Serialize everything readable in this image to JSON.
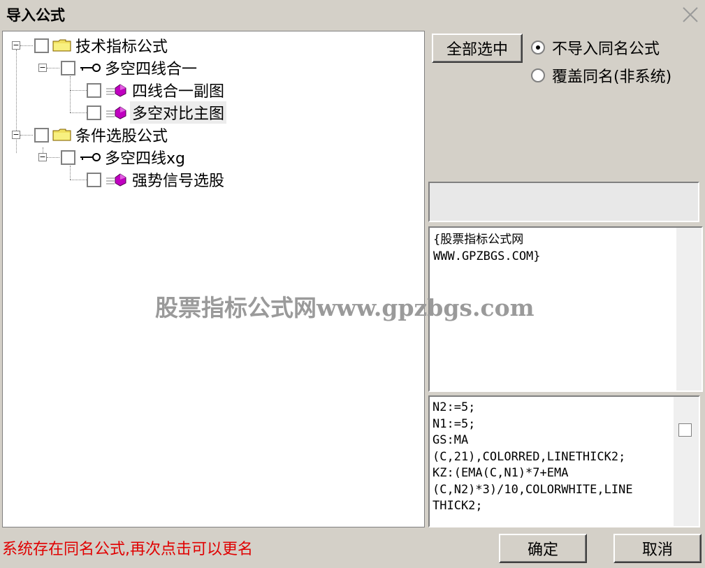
{
  "window": {
    "title": "导入公式"
  },
  "tree": {
    "nodes": [
      {
        "label": "技术指标公式",
        "icon": "folder-icon"
      },
      {
        "label": "多空四线合一",
        "icon": "key-icon"
      },
      {
        "label": "四线合一副图",
        "icon": "formula-gem-icon"
      },
      {
        "label": "多空对比主图",
        "icon": "formula-gem-icon"
      },
      {
        "label": "条件选股公式",
        "icon": "folder-icon"
      },
      {
        "label": "多空四线xg",
        "icon": "key-icon"
      },
      {
        "label": "强势信号选股",
        "icon": "formula-gem-icon"
      }
    ]
  },
  "options": {
    "select_all_label": "全部选中",
    "radio_no_import": "不导入同名公式",
    "radio_overwrite": "覆盖同名(非系统)",
    "selected": "no_import"
  },
  "description_lines": [
    "{股票指标公式网",
    "WWW.GPZBGS.COM}"
  ],
  "code_lines": [
    "N2:=5;",
    "N1:=5;",
    "GS:MA",
    "(C,21),COLORRED,LINETHICK2;",
    "KZ:(EMA(C,N1)*7+EMA",
    "(C,N2)*3)/10,COLORWHITE,LINE",
    "THICK2;"
  ],
  "watermark": "股票指标公式网www.gpzbgs.com",
  "status_text": "系统存在同名公式,再次点击可以更名",
  "buttons": {
    "ok": "确定",
    "cancel": "取消"
  },
  "colors": {
    "status_red": "#e00000",
    "gem_purple": "#c000c0",
    "folder_yellow": "#f0e060"
  }
}
